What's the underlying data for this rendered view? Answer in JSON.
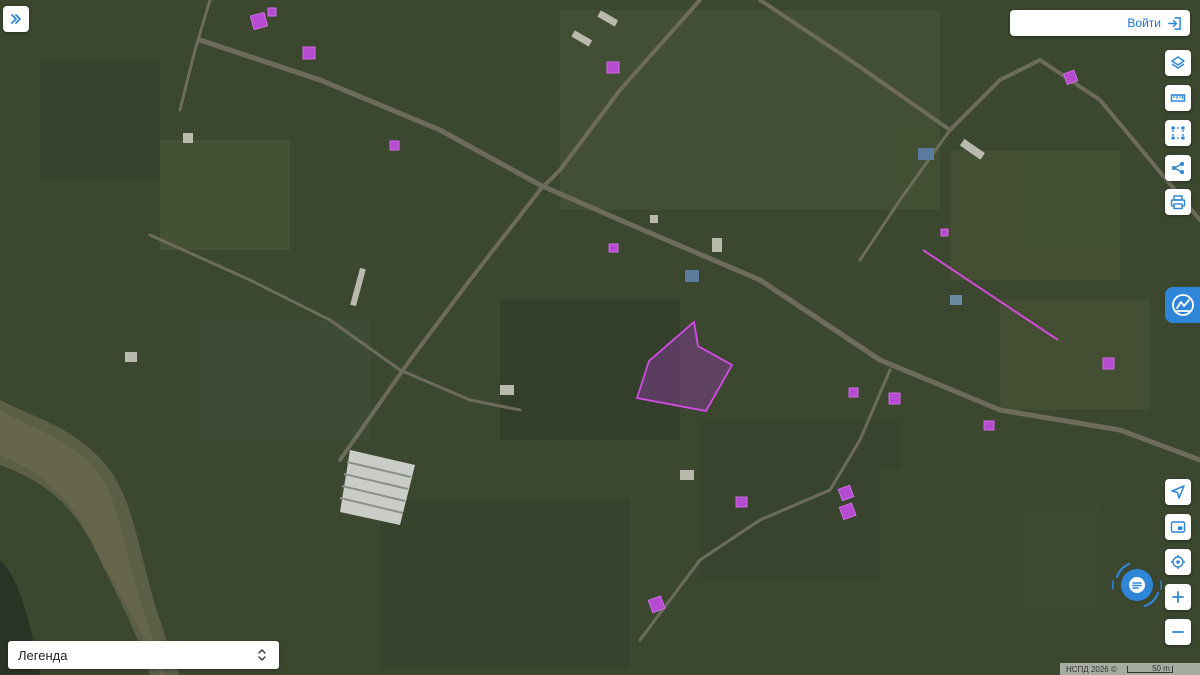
{
  "header": {
    "login_label": "Войти"
  },
  "legend": {
    "label": "Легенда"
  },
  "attribution": {
    "text": "НСПД 2026 ©",
    "scale_label": "50 m"
  },
  "toolbar": {
    "top_icons": [
      "layers-icon",
      "ruler-icon",
      "area-select-icon",
      "share-icon",
      "print-icon"
    ],
    "bottom_icons": [
      "navigate-icon",
      "minimap-icon",
      "locate-icon",
      "zoom-in-icon",
      "zoom-out-icon"
    ]
  },
  "colors": {
    "accent": "#2f86d8",
    "highlight_parcel": "#c93cd8",
    "parcel_fill": "#b54bd0",
    "satellite_base": "#3a4630"
  }
}
